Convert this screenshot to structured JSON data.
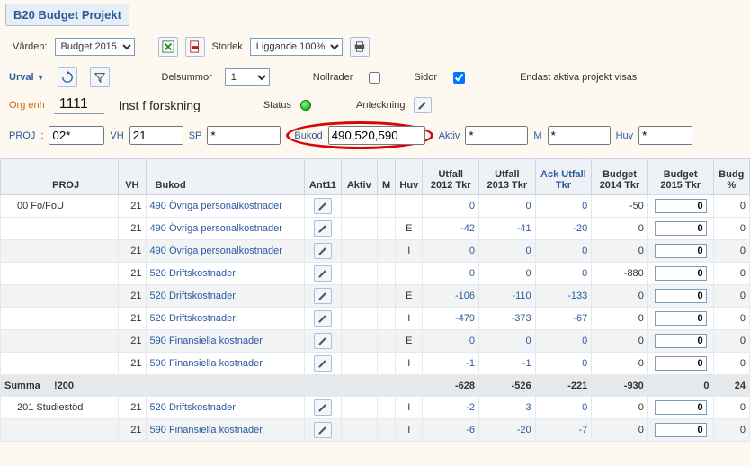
{
  "title": "B20 Budget Projekt",
  "toolbar": {
    "varden_label": "Värden:",
    "varden_value": "Budget 2015",
    "storlek_label": "Storlek",
    "storlek_value": "Liggande 100%"
  },
  "controls": {
    "urval_label": "Urval",
    "delsummor_label": "Delsummor",
    "delsummor_value": "1",
    "nollrader_label": "Nollrader",
    "sidor_label": "Sidor",
    "aktiva_text": "Endast aktiva projekt visas"
  },
  "header": {
    "orgenh_label": "Org enh",
    "orgenh_value": "1111",
    "orgenh_name": "Inst f forskning",
    "status_label": "Status",
    "anteckning_label": "Anteckning"
  },
  "filters": {
    "proj_label": "PROJ",
    "proj_value": "02*",
    "vh_label": "VH",
    "vh_value": "21",
    "sp_label": "SP",
    "sp_value": "*",
    "bukod_label": "Bukod",
    "bukod_value": "490,520,590",
    "aktiv_label": "Aktiv",
    "aktiv_value": "*",
    "m_label": "M",
    "m_value": "*",
    "huv_label": "Huv",
    "huv_value": "*"
  },
  "columns": {
    "proj": "PROJ",
    "vh": "VH",
    "bukod": "Bukod",
    "ant11": "Ant11",
    "aktiv": "Aktiv",
    "m": "M",
    "huv": "Huv",
    "utfall2012": "Utfall 2012 Tkr",
    "utfall2013": "Utfall 2013 Tkr",
    "ack": "Ack Utfall Tkr",
    "budget2014": "Budget 2014 Tkr",
    "budget2015": "Budget 2015 Tkr",
    "budgpct": "Budg %"
  },
  "rows": [
    {
      "proj": "00 Fo/FoU",
      "vh": "21",
      "bukod": "490 Övriga personalkostnader",
      "m": "",
      "huv": "",
      "u12": "0",
      "u13": "0",
      "ack": "0",
      "b14": "-50",
      "b15": "0",
      "pct": "0",
      "stripe": false
    },
    {
      "proj": "",
      "vh": "21",
      "bukod": "490 Övriga personalkostnader",
      "m": "",
      "huv": "E",
      "u12": "-42",
      "u13": "-41",
      "ack": "-20",
      "b14": "0",
      "b15": "0",
      "pct": "0",
      "stripe": false
    },
    {
      "proj": "",
      "vh": "21",
      "bukod": "490 Övriga personalkostnader",
      "m": "",
      "huv": "I",
      "u12": "0",
      "u13": "0",
      "ack": "0",
      "b14": "0",
      "b15": "0",
      "pct": "0",
      "stripe": true
    },
    {
      "proj": "",
      "vh": "21",
      "bukod": "520 Driftskostnader",
      "m": "",
      "huv": "",
      "u12": "0",
      "u13": "0",
      "ack": "0",
      "b14": "-880",
      "b15": "0",
      "pct": "0",
      "stripe": false
    },
    {
      "proj": "",
      "vh": "21",
      "bukod": "520 Driftskostnader",
      "m": "",
      "huv": "E",
      "u12": "-106",
      "u13": "-110",
      "ack": "-133",
      "b14": "0",
      "b15": "0",
      "pct": "0",
      "stripe": true
    },
    {
      "proj": "",
      "vh": "21",
      "bukod": "520 Driftskostnader",
      "m": "",
      "huv": "I",
      "u12": "-479",
      "u13": "-373",
      "ack": "-67",
      "b14": "0",
      "b15": "0",
      "pct": "0",
      "stripe": false
    },
    {
      "proj": "",
      "vh": "21",
      "bukod": "590 Finansiella kostnader",
      "m": "",
      "huv": "E",
      "u12": "0",
      "u13": "0",
      "ack": "0",
      "b14": "0",
      "b15": "0",
      "pct": "0",
      "stripe": true
    },
    {
      "proj": "",
      "vh": "21",
      "bukod": "590 Finansiella kostnader",
      "m": "",
      "huv": "I",
      "u12": "-1",
      "u13": "-1",
      "ack": "0",
      "b14": "0",
      "b15": "0",
      "pct": "0",
      "stripe": false
    }
  ],
  "sum": {
    "label": "Summa",
    "code": "!200",
    "u12": "-628",
    "u13": "-526",
    "ack": "-221",
    "b14": "-930",
    "b15": "0",
    "pct": "24"
  },
  "rows2": [
    {
      "proj": "201 Studiestöd",
      "vh": "21",
      "bukod": "520 Driftskostnader",
      "m": "",
      "huv": "I",
      "u12": "-2",
      "u13": "3",
      "ack": "0",
      "b14": "0",
      "b15": "0",
      "pct": "0",
      "stripe": false
    },
    {
      "proj": "",
      "vh": "21",
      "bukod": "590 Finansiella kostnader",
      "m": "",
      "huv": "I",
      "u12": "-6",
      "u13": "-20",
      "ack": "-7",
      "b14": "0",
      "b15": "0",
      "pct": "0",
      "stripe": true
    }
  ]
}
